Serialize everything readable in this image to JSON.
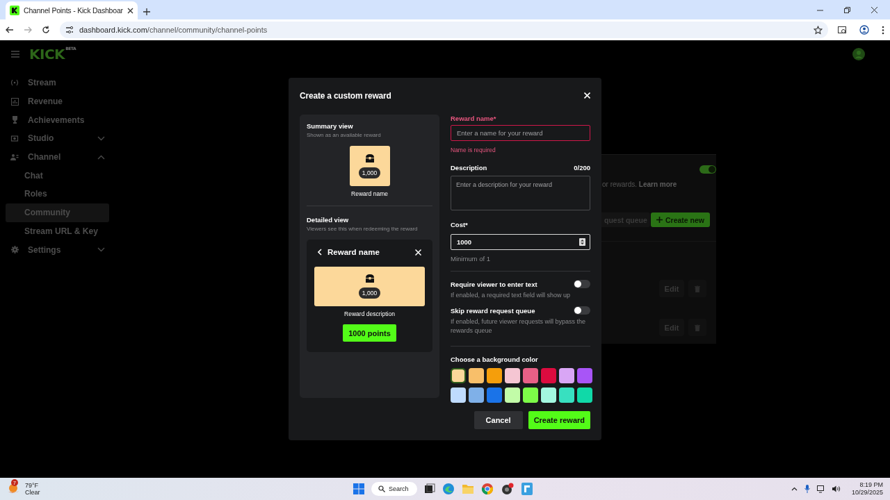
{
  "browser": {
    "tab_title": "Channel Points - Kick Dashboar",
    "url_host": "dashboard.kick.com",
    "url_path": "/channel/community/channel-points"
  },
  "header": {
    "logo": "KICK",
    "logo_badge": "BETA"
  },
  "sidebar": {
    "items": [
      {
        "label": "Stream",
        "kind": "link",
        "selected": false
      },
      {
        "label": "Revenue",
        "kind": "link",
        "selected": false
      },
      {
        "label": "Achievements",
        "kind": "link",
        "selected": false
      },
      {
        "label": "Studio",
        "kind": "group",
        "selected": false,
        "expanded": false
      },
      {
        "label": "Channel",
        "kind": "group",
        "selected": false,
        "expanded": true,
        "children": [
          {
            "label": "Chat",
            "selected": false
          },
          {
            "label": "Roles",
            "selected": false
          },
          {
            "label": "Community",
            "selected": true
          },
          {
            "label": "Stream URL & Key",
            "selected": false
          }
        ]
      },
      {
        "label": "Settings",
        "kind": "group",
        "selected": false,
        "expanded": false
      }
    ]
  },
  "background_page": {
    "rewards_enabled": true,
    "hint": "or rewards.",
    "link": "Learn more",
    "queue_button": "quest queue",
    "create_button": "Create new",
    "rows": [
      {
        "edit": "Edit"
      },
      {
        "edit": "Edit"
      }
    ]
  },
  "modal": {
    "title": "Create a custom reward",
    "summary": {
      "heading": "Summary view",
      "subheading": "Shown as an available reward",
      "cost": "1,000",
      "name": "Reward name"
    },
    "detailed": {
      "heading": "Detailed view",
      "subheading": "Viewers see this when redeeming the reward",
      "title": "Reward name",
      "cost": "1,000",
      "description": "Reward description",
      "points": "1000 points"
    },
    "reward_name": {
      "label": "Reward name*",
      "placeholder": "Enter a name for your reward",
      "error": "Name is required"
    },
    "description": {
      "label": "Description",
      "counter": "0/200",
      "placeholder": "Enter a description for your reward"
    },
    "cost": {
      "label": "Cost*",
      "value": "1000",
      "hint": "Minimum of 1"
    },
    "toggles": [
      {
        "label": "Require viewer to enter text",
        "hint": "If enabled, a required text field will show up",
        "on": false
      },
      {
        "label": "Skip reward request queue",
        "hint": "If enabled, future viewer requests will bypass the rewards queue",
        "on": false
      }
    ],
    "colors": {
      "label": "Choose a background color",
      "swatches": [
        {
          "color": "#fcd89a",
          "selected": true
        },
        {
          "color": "#f8bf6a",
          "selected": false
        },
        {
          "color": "#f59e0b",
          "selected": false
        },
        {
          "color": "#f5c6d3",
          "selected": false
        },
        {
          "color": "#e76086",
          "selected": false
        },
        {
          "color": "#dc0b3f",
          "selected": false
        },
        {
          "color": "#d9a6f5",
          "selected": false
        },
        {
          "color": "#a855f7",
          "selected": false
        },
        {
          "color": "#bfdbfe",
          "selected": false
        },
        {
          "color": "#7fb0e8",
          "selected": false
        },
        {
          "color": "#1a73e8",
          "selected": false
        },
        {
          "color": "#c2fca8",
          "selected": false
        },
        {
          "color": "#7dfb48",
          "selected": false
        },
        {
          "color": "#a3f7e0",
          "selected": false
        },
        {
          "color": "#38e0c0",
          "selected": false
        },
        {
          "color": "#10d9a8",
          "selected": false
        }
      ]
    },
    "cancel": "Cancel",
    "create": "Create reward"
  },
  "taskbar": {
    "weather_badge": "7",
    "temperature": "79°F",
    "condition": "Clear",
    "search": "Search",
    "time": "8:19 PM",
    "date": "10/29/2025"
  }
}
